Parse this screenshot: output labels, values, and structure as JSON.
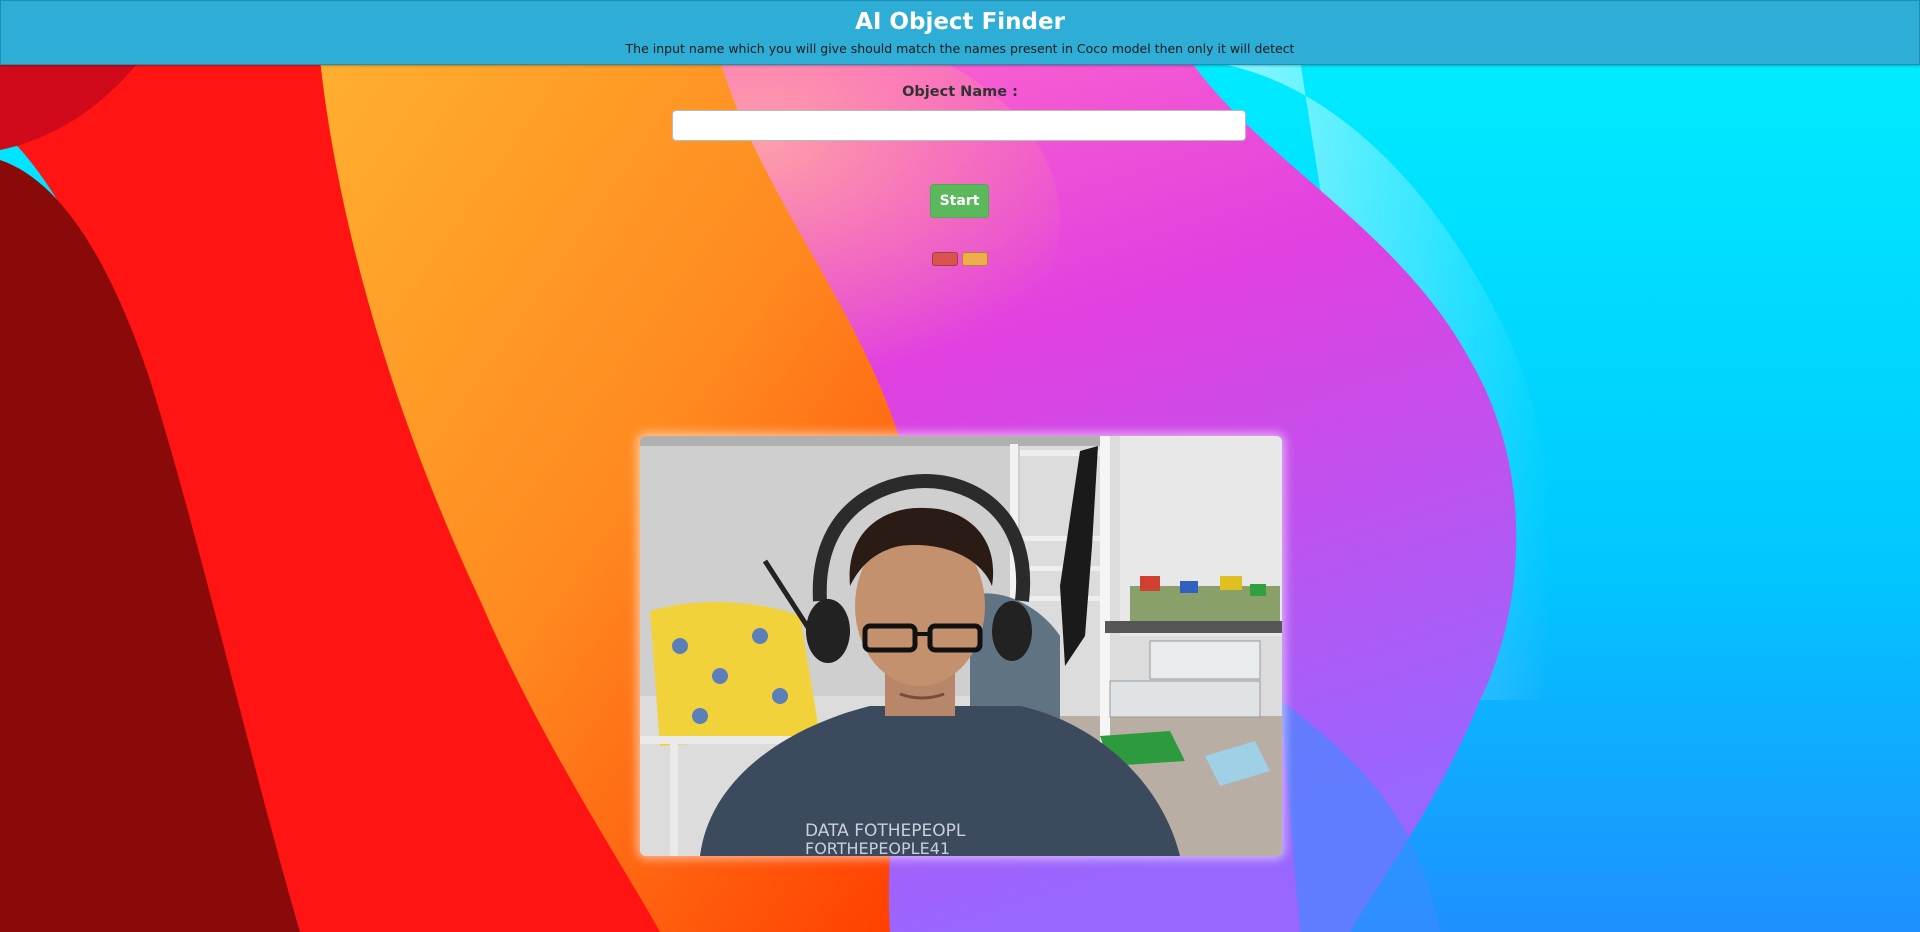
{
  "header": {
    "title": "AI Object Finder",
    "subtitle": "The input name which you will give should match the names present in Coco model then only it will detect"
  },
  "form": {
    "label": "Object Name :",
    "input_value": "",
    "input_placeholder": "",
    "start_label": "Start"
  },
  "video": {
    "shirt_text_line1": "DATA FOTHEPEOPL",
    "shirt_text_line2": "FORTHEPEOPLE41"
  },
  "colors": {
    "header_bg": "#2eaed6",
    "start_button": "#5cb85c",
    "stop_button": "#d9534f",
    "pause_button": "#f0ad4e"
  }
}
